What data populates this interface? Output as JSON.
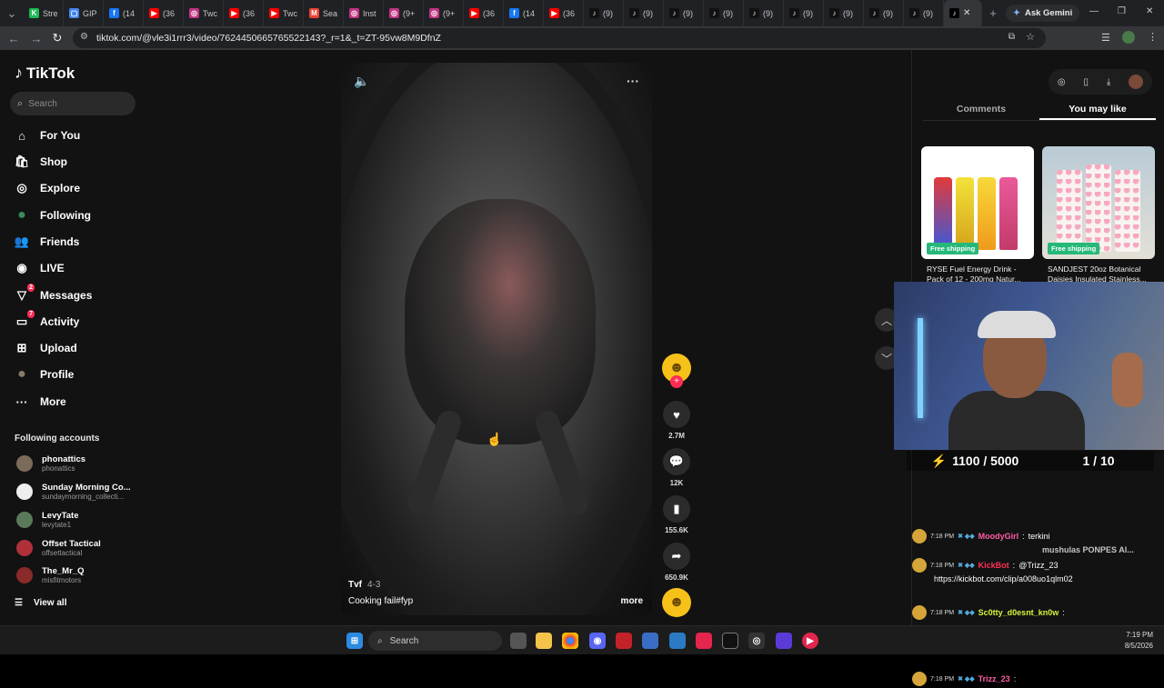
{
  "browser": {
    "tabs": [
      {
        "label": "Stre",
        "color": "#1db954",
        "glyph": "K"
      },
      {
        "label": "GIP",
        "color": "#4285f4",
        "glyph": "▢"
      },
      {
        "label": "(14",
        "color": "#1877f2",
        "glyph": "f"
      },
      {
        "label": "(36",
        "color": "#ff0000",
        "glyph": "▶"
      },
      {
        "label": "Twc",
        "color": "#c13584",
        "glyph": "◎"
      },
      {
        "label": "(36",
        "color": "#ff0000",
        "glyph": "▶"
      },
      {
        "label": "Twc",
        "color": "#ff0000",
        "glyph": "▶"
      },
      {
        "label": "Sea",
        "color": "#ea4335",
        "glyph": "M"
      },
      {
        "label": "Inst",
        "color": "#c13584",
        "glyph": "◎"
      },
      {
        "label": "(9+",
        "color": "#c13584",
        "glyph": "◎"
      },
      {
        "label": "(9+",
        "color": "#c13584",
        "glyph": "◎"
      },
      {
        "label": "(36",
        "color": "#ff0000",
        "glyph": "▶"
      },
      {
        "label": "(14",
        "color": "#1877f2",
        "glyph": "f"
      },
      {
        "label": "(36",
        "color": "#ff0000",
        "glyph": "▶"
      },
      {
        "label": "(9)",
        "color": "#111111",
        "glyph": "♪"
      },
      {
        "label": "(9)",
        "color": "#111111",
        "glyph": "♪"
      },
      {
        "label": "(9)",
        "color": "#111111",
        "glyph": "♪"
      },
      {
        "label": "(9)",
        "color": "#111111",
        "glyph": "♪"
      },
      {
        "label": "(9)",
        "color": "#111111",
        "glyph": "♪"
      },
      {
        "label": "(9)",
        "color": "#111111",
        "glyph": "♪"
      },
      {
        "label": "(9)",
        "color": "#111111",
        "glyph": "♪"
      },
      {
        "label": "(9)",
        "color": "#111111",
        "glyph": "♪"
      },
      {
        "label": "(9)",
        "color": "#111111",
        "glyph": "♪"
      }
    ],
    "ask_gemini": "Ask Gemini",
    "url": "tiktok.com/@vle3i1rrr3/video/7624450665765522143?_r=1&_t=ZT-95vw8M9DfnZ"
  },
  "sidebar": {
    "logo": "TikTok",
    "search_placeholder": "Search",
    "nav": [
      {
        "label": "For You",
        "icon": "home-icon",
        "glyph": "⌂"
      },
      {
        "label": "Shop",
        "icon": "shop-icon",
        "glyph": "🛍"
      },
      {
        "label": "Explore",
        "icon": "compass-icon",
        "glyph": "◎"
      },
      {
        "label": "Following",
        "icon": "following-avatar-icon",
        "glyph": "●"
      },
      {
        "label": "Friends",
        "icon": "friends-icon",
        "glyph": "👥"
      },
      {
        "label": "LIVE",
        "icon": "live-icon",
        "glyph": "◉"
      },
      {
        "label": "Messages",
        "icon": "messages-icon",
        "glyph": "▽",
        "badge": "2"
      },
      {
        "label": "Activity",
        "icon": "activity-icon",
        "glyph": "▭",
        "badge": "7"
      },
      {
        "label": "Upload",
        "icon": "upload-icon",
        "glyph": "⊞"
      },
      {
        "label": "Profile",
        "icon": "profile-avatar-icon",
        "glyph": "●"
      },
      {
        "label": "More",
        "icon": "more-icon",
        "glyph": "···"
      }
    ],
    "following_title": "Following accounts",
    "following": [
      {
        "name": "phonattics",
        "handle": "phonattics",
        "color": "#7a6b5a"
      },
      {
        "name": "Sunday Morning Co...",
        "handle": "sundaymorning_collecti...",
        "color": "#eeeeee"
      },
      {
        "name": "LevyTate",
        "handle": "levytate1",
        "color": "#5a7a5a"
      },
      {
        "name": "Offset Tactical",
        "handle": "offsettactical",
        "color": "#b0303a"
      },
      {
        "name": "The_Mr_Q",
        "handle": "misfitmotors",
        "color": "#8a2a2a"
      }
    ],
    "view_all": "View all"
  },
  "video": {
    "author": "Tvf",
    "date": "4-3",
    "caption": "Cooking fail#fyp",
    "more": "more"
  },
  "actions": {
    "likes": "2.7M",
    "comments": "12K",
    "saves": "155.6K",
    "shares": "650.9K"
  },
  "right_panel": {
    "tabs": [
      "Comments",
      "You may like"
    ],
    "products": [
      {
        "title": "RYSE Fuel Energy Drink - Pack of 12 - 200mg Natur...",
        "badge": "Free shipping"
      },
      {
        "title": "SANDJEST 20oz Botanical Daisies Insulated Stainless...",
        "badge": "Free shipping"
      }
    ]
  },
  "overlay": {
    "goal_left": "1100 / 5000",
    "goal_right": "1 / 10",
    "chat": [
      {
        "time": "7:18 PM",
        "user": "MoodyGirl",
        "user_color": "#ff5ca8",
        "msg": "terkini"
      },
      {
        "time": "7:18 PM",
        "user": "KickBot",
        "user_color": "#ff3355",
        "msg": "@Trizz_23"
      },
      {
        "time": "7:18 PM",
        "user": "Sc0tty_d0esnt_kn0w",
        "user_color": "#d6f53a",
        "msg": ""
      },
      {
        "time": "7:18 PM",
        "user": "Trizz_23",
        "user_color": "#ff5ca8",
        "msg": ""
      },
      {
        "time": "7:18 PM",
        "user": "Trizz_23",
        "user_color": "#ff5ca8",
        "msg": ""
      }
    ],
    "chat_link": "https://kickbot.com/clip/a008uo1qlm02",
    "ghost_text": "mushulas PONPES Al..."
  },
  "taskbar": {
    "search": "Search",
    "time": "7:19 PM",
    "date": "8/5/2026"
  }
}
